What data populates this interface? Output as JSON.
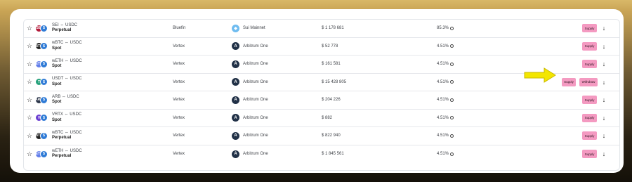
{
  "rows": [
    {
      "base": "SEI",
      "pair": "SEI ⇔ USDC",
      "type": "Perpetual",
      "dex": "Bluefin",
      "chain": "Sui Mainnet",
      "chain_icon": "sui",
      "tvl": "$ 1 178 681",
      "apy": "85.3%",
      "base_color": "#b31b3a",
      "actions": [
        "Supply"
      ]
    },
    {
      "base": "BTC",
      "pair": "wBTC ⇔ USDC",
      "type": "Spot",
      "dex": "Vertex",
      "chain": "Arbitrum One",
      "chain_icon": "arb",
      "tvl": "$ 52 778",
      "apy": "4.51%",
      "base_color": "#222222",
      "actions": [
        "Supply"
      ]
    },
    {
      "base": "ETH",
      "pair": "wETH ⇔ USDC",
      "type": "Spot",
      "dex": "Vertex",
      "chain": "Arbitrum One",
      "chain_icon": "arb",
      "tvl": "$ 161 581",
      "apy": "4.51%",
      "base_color": "#627eea",
      "actions": [
        "Supply"
      ]
    },
    {
      "base": "T",
      "pair": "USDT ⇔ USDC",
      "type": "Spot",
      "dex": "Vertex",
      "chain": "Arbitrum One",
      "chain_icon": "arb",
      "tvl": "$ 15 428 805",
      "apy": "4.51%",
      "base_color": "#26a17b",
      "actions": [
        "Supply",
        "Withdraw"
      ]
    },
    {
      "base": "ARB",
      "pair": "ARB ⇔ USDC",
      "type": "Spot",
      "dex": "Vertex",
      "chain": "Arbitrum One",
      "chain_icon": "arb",
      "tvl": "$ 204 226",
      "apy": "4.51%",
      "base_color": "#2d374b",
      "actions": [
        "Supply"
      ]
    },
    {
      "base": "V",
      "pair": "VRTX ⇔ USDC",
      "type": "Spot",
      "dex": "Vertex",
      "chain": "Arbitrum One",
      "chain_icon": "arb",
      "tvl": "$ 882",
      "apy": "4.51%",
      "base_color": "#6b3fd1",
      "actions": [
        "Supply"
      ]
    },
    {
      "base": "BTC",
      "pair": "wBTC ⇔ USDC",
      "type": "Perpetual",
      "dex": "Vertex",
      "chain": "Arbitrum One",
      "chain_icon": "arb",
      "tvl": "$ 822 940",
      "apy": "4.51%",
      "base_color": "#222222",
      "actions": [
        "Supply"
      ]
    },
    {
      "base": "ETH",
      "pair": "wETH ⇔ USDC",
      "type": "Perpetual",
      "dex": "Vertex",
      "chain": "Arbitrum One",
      "chain_icon": "arb",
      "tvl": "$ 1 845 561",
      "apy": "4.51%",
      "base_color": "#627eea",
      "actions": [
        "Supply"
      ]
    }
  ],
  "colors": {
    "accent_button": "#f49ac1",
    "pointer_arrow": "#f3e600"
  }
}
